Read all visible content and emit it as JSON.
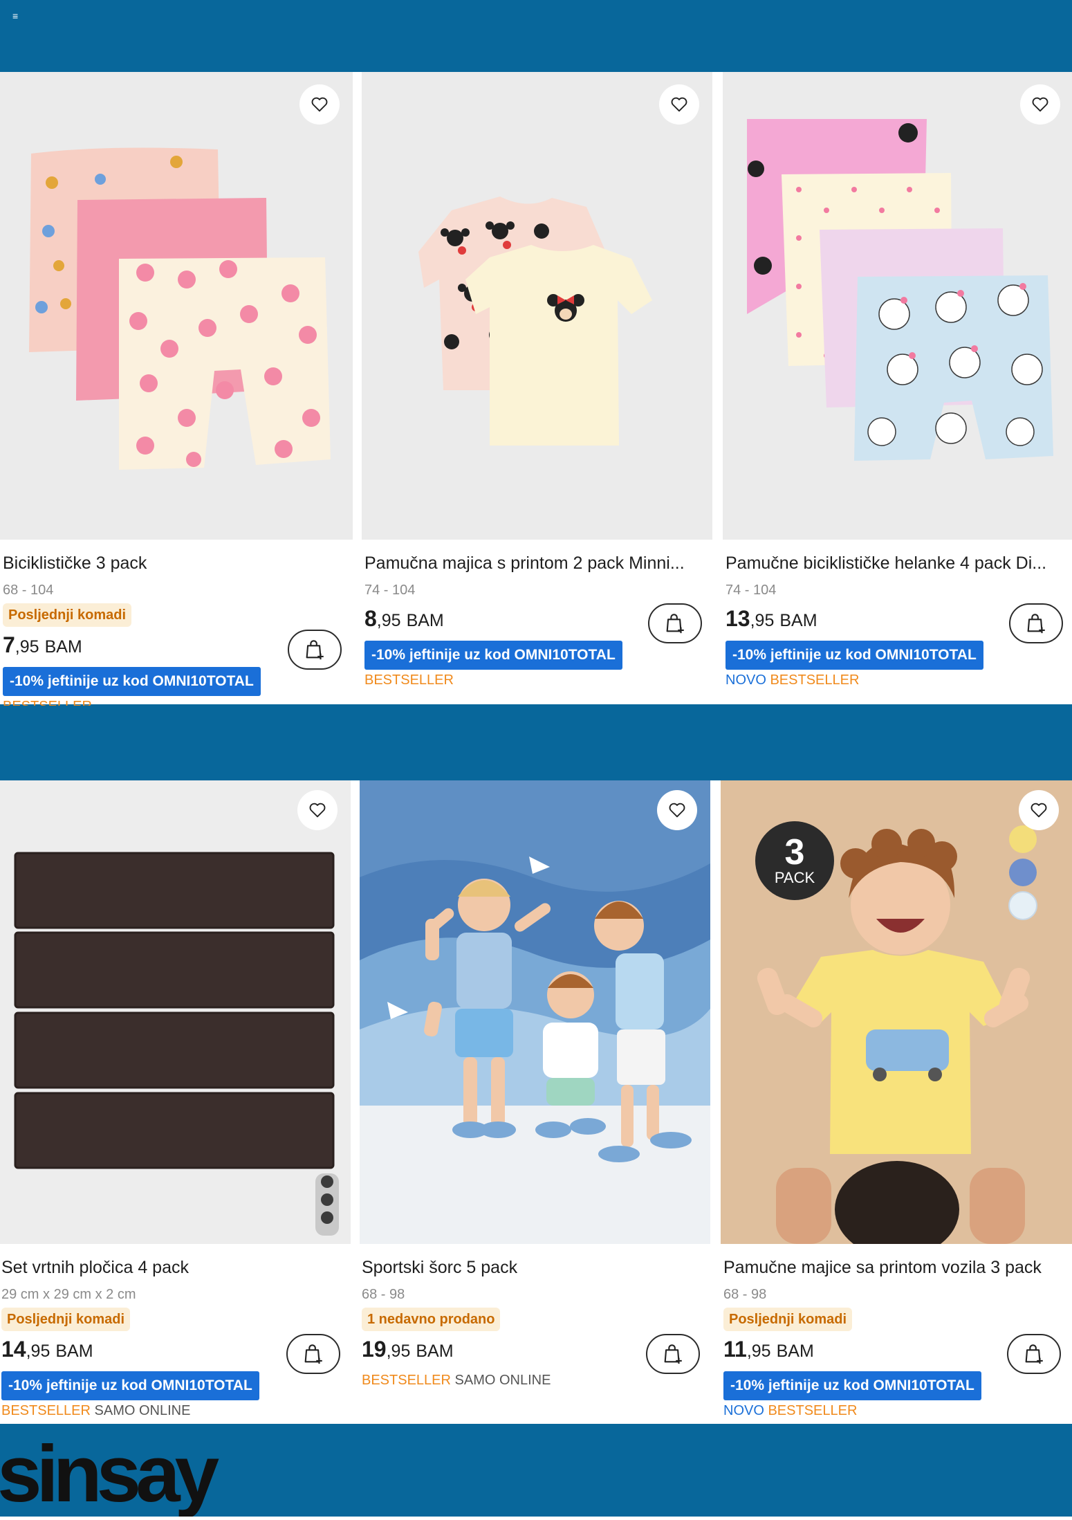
{
  "header": {
    "menu_glyph": "≡"
  },
  "colors": {
    "brand_blue": "#08679b",
    "promo_blue": "#1a6fd8",
    "badge_bg": "#fbeed6",
    "badge_text": "#c76a00",
    "bestseller": "#f08a1c",
    "new": "#1a6fd8"
  },
  "icons": {
    "wishlist": "heart-icon",
    "cart": "add-to-cart-bag-icon"
  },
  "products": [
    {
      "title": "Biciklističke 3 pack",
      "sizes": "68 - 104",
      "badge": "Posljednji komadi",
      "price_int": "7",
      "price_dec": ",95",
      "currency": "BAM",
      "promo": "-10% jeftinije uz kod OMNI10TOTAL",
      "tag_1": "BESTSELLER",
      "tag_2": ""
    },
    {
      "title": "Pamučna majica s printom 2 pack Minni...",
      "sizes": "74 - 104",
      "badge": "",
      "price_int": "8",
      "price_dec": ",95",
      "currency": "BAM",
      "promo": "-10% jeftinije uz kod OMNI10TOTAL",
      "tag_1": "BESTSELLER",
      "tag_2": ""
    },
    {
      "title": "Pamučne biciklističke helanke 4 pack Di...",
      "sizes": "74 - 104",
      "badge": "",
      "price_int": "13",
      "price_dec": ",95",
      "currency": "BAM",
      "promo": "-10% jeftinije uz kod OMNI10TOTAL",
      "tag_1": "NOVO",
      "tag_2": "BESTSELLER"
    },
    {
      "title": "Set vrtnih pločica 4 pack",
      "sizes": "29 cm x 29 cm x 2 cm",
      "badge": "Posljednji komadi",
      "price_int": "14",
      "price_dec": ",95",
      "currency": "BAM",
      "promo": "-10% jeftinije uz kod OMNI10TOTAL",
      "tag_1": "BESTSELLER",
      "tag_2": "SAMO ONLINE"
    },
    {
      "title": "Sportski šorc 5 pack",
      "sizes": "68 - 98",
      "badge": "1 nedavno prodano",
      "price_int": "19",
      "price_dec": ",95",
      "currency": "BAM",
      "promo": "",
      "tag_1": "BESTSELLER",
      "tag_2": "SAMO ONLINE"
    },
    {
      "title": "Pamučne majice sa printom vozila 3 pack",
      "sizes": "68 - 98",
      "badge": "Posljednji komadi",
      "price_int": "11",
      "price_dec": ",95",
      "currency": "BAM",
      "promo": "-10% jeftinije uz kod OMNI10TOTAL",
      "tag_1": "NOVO",
      "tag_2": "BESTSELLER"
    }
  ],
  "pack_badge": {
    "number": "3",
    "label": "PACK"
  },
  "logo_text": "sinsay"
}
